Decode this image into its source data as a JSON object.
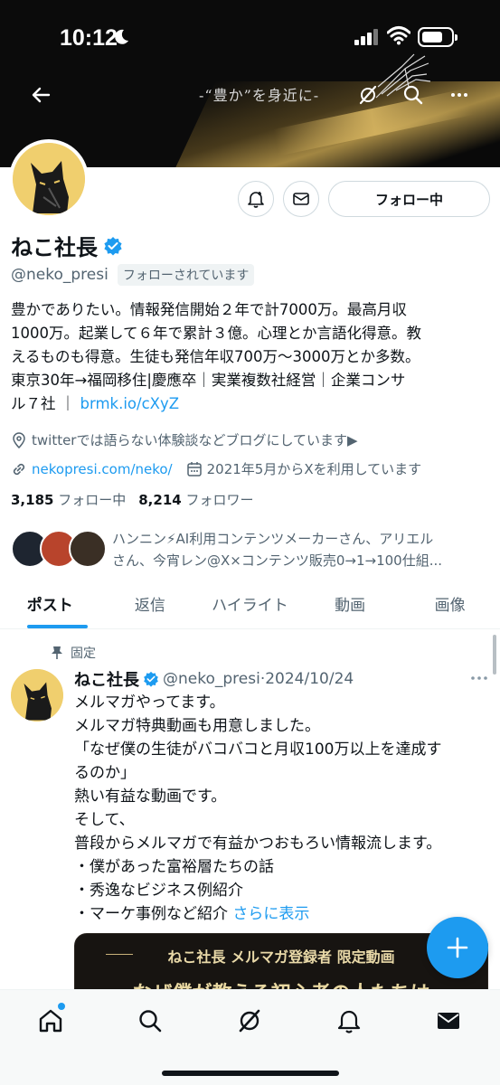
{
  "status_bar": {
    "time": "10:12"
  },
  "header": {
    "banner_title": "-“豊か”を身近に-"
  },
  "profile": {
    "name": "ねこ社長",
    "handle": "@neko_presi",
    "follows_you": "フォローされています",
    "follow_button": "フォロー中",
    "bio": {
      "line1": "豊かでありたい。情報発信開始２年で計7000万。最高月収",
      "line2": "1000万。起業して６年で累計３億。心理とか言語化得意。教",
      "line3": "えるものも得意。生徒も発信年収700万〜3000万とか多数。",
      "line4": "東京30年→福岡移住|慶應卒｜実業複数社経営｜企業コンサ",
      "line5_prefix": "ル７社 ｜ ",
      "link": "brmk.io/cXyZ"
    },
    "location": "twitterでは語らない体験談などブログにしています▶",
    "website": "nekopresi.com/neko/",
    "joined": "2021年5月からXを利用しています",
    "following_count": "3,185",
    "following_label": "フォロー中",
    "followers_count": "8,214",
    "followers_label": "フォロワー",
    "followed_by_line1": "ハンニン⚡AI利用コンテンツメーカーさん、アリエル",
    "followed_by_line2": "さん、今宵レン@X×コンテンツ販売0→1→100仕組..."
  },
  "tabs": [
    {
      "label": "ポスト",
      "active": true
    },
    {
      "label": "返信",
      "active": false
    },
    {
      "label": "ハイライト",
      "active": false
    },
    {
      "label": "動画",
      "active": false
    },
    {
      "label": "画像",
      "active": false
    }
  ],
  "post": {
    "pinned_label": "固定",
    "author": "ねこ社長",
    "handle_date": "@neko_presi·2024/10/24",
    "lines": [
      "メルマガやってます。",
      "メルマガ特典動画も用意しました。",
      "「なぜ僕の生徒がバコバコと月収100万以上を達成す",
      "るのか」",
      "熱い有益な動画です。",
      "そして、",
      "普段からメルマガで有益かつおもろい情報流します。",
      "・僕があった富裕層たちの話",
      "・秀逸なビジネス例紹介"
    ],
    "last_line": "・マーケ事例など紹介 ",
    "show_more": "さらに表示",
    "media_caption": "ねこ社長 メルマガ登録者 限定動画",
    "media_subtitle": "なぜ僕が教える初心者の人たちは"
  },
  "fab_label": "+",
  "colors": {
    "accent": "#1d9bf0",
    "text": "#0f1419",
    "muted": "#536471"
  }
}
